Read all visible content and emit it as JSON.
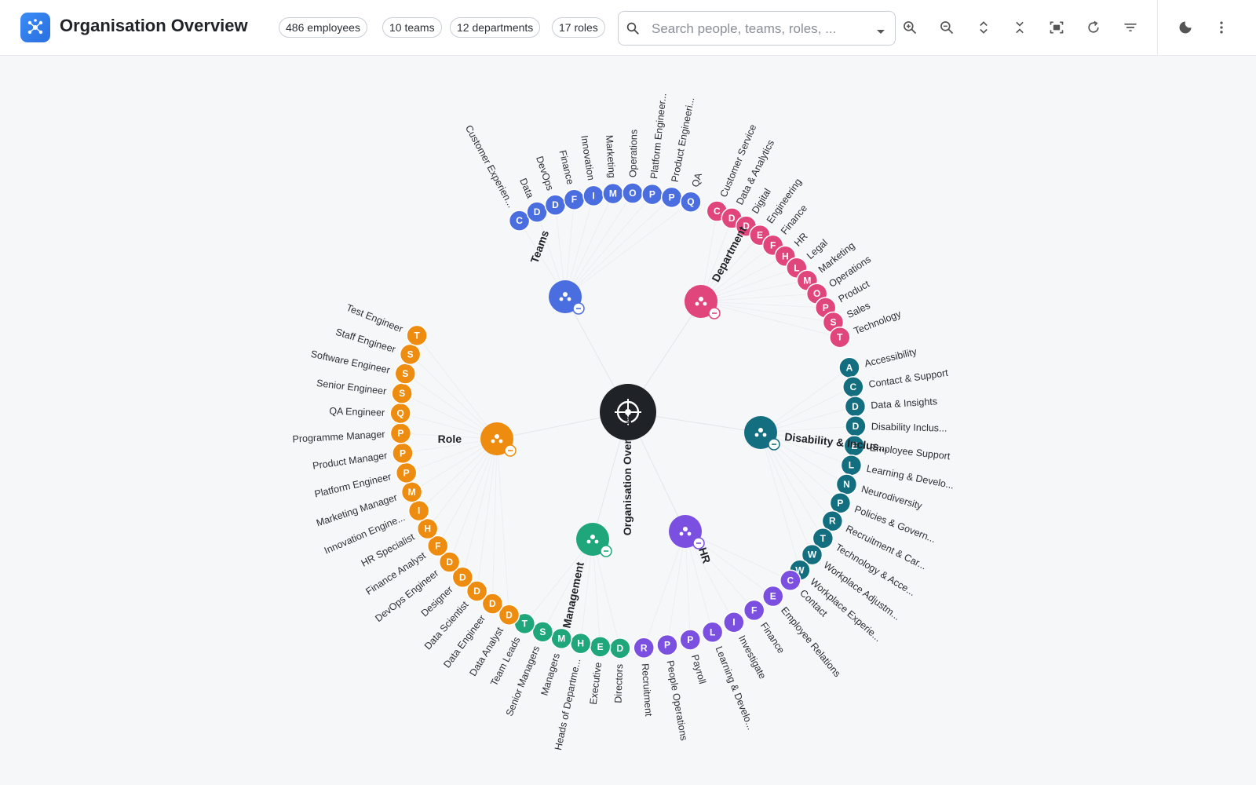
{
  "header": {
    "title": "Organisation Overview",
    "stats": [
      "486 employees",
      "10 teams",
      "12 departments",
      "17 roles"
    ],
    "search_placeholder": "Search people, teams, roles, ..."
  },
  "toolbar": {
    "icons": [
      "zoom-in-icon",
      "zoom-out-icon",
      "expand-vertical-icon",
      "collapse-vertical-icon",
      "fit-screen-icon",
      "refresh-icon",
      "filter-icon",
      "dark-mode-icon",
      "more-options-icon"
    ]
  },
  "graph": {
    "center_label": "Organisation Overview",
    "hubs": [
      {
        "label": "Teams",
        "color": "#4a6ee0",
        "icon": "team-icon",
        "children": [
          "Customer Experien...",
          "Data",
          "DevOps",
          "Finance",
          "Innovation",
          "Marketing",
          "Operations",
          "Platform Engineer...",
          "Product Engineeri...",
          "QA"
        ]
      },
      {
        "label": "Department",
        "color": "#e0457b",
        "icon": "department-icon",
        "children": [
          "Customer Service",
          "Data & Analytics",
          "Digital",
          "Engineering",
          "Finance",
          "HR",
          "Legal",
          "Marketing",
          "Operations",
          "Product",
          "Sales",
          "Technology"
        ]
      },
      {
        "label": "Disability & Inclus...",
        "color": "#136f80",
        "icon": "accessibility-icon",
        "children": [
          "Accessibility",
          "Contact & Support",
          "Data & Insights",
          "Disability Inclus...",
          "Employee Support",
          "Learning & Develo...",
          "Neurodiversity",
          "Policies & Govern...",
          "Recruitment & Car...",
          "Technology & Acce...",
          "Workplace Adjustm...",
          "Workplace Experie..."
        ]
      },
      {
        "label": "HR",
        "color": "#7b4fe0",
        "icon": "people-icon",
        "children": [
          "Contact",
          "Employee Relations",
          "Finance",
          "Investigate",
          "Learning & Develo...",
          "Payroll",
          "People Operations",
          "Recruitment"
        ]
      },
      {
        "label": "Management",
        "color": "#1fa67a",
        "icon": "hierarchy-icon",
        "children": [
          "Directors",
          "Executive",
          "Heads of Departme...",
          "Managers",
          "Senior Managers",
          "Team Leads"
        ]
      },
      {
        "label": "Role",
        "color": "#ee8c0f",
        "icon": "badge-icon",
        "children": [
          "Data Analyst",
          "Data Engineer",
          "Data Scientist",
          "Designer",
          "DevOps Engineer",
          "Finance Analyst",
          "HR Specialist",
          "Innovation Engine...",
          "Marketing Manager",
          "Platform Engineer",
          "Product Manager",
          "Programme Manager",
          "QA Engineer",
          "Senior Engineer",
          "Software Engineer",
          "Staff Engineer",
          "Test Engineer"
        ]
      }
    ]
  }
}
